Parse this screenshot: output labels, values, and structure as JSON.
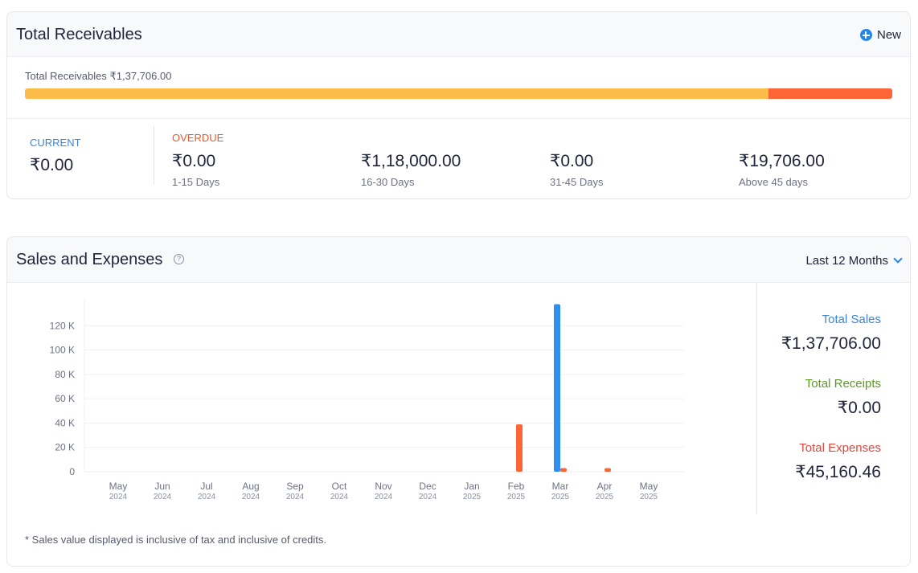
{
  "receivables": {
    "title": "Total Receivables",
    "new_label": "New",
    "total_text": "Total Receivables ₹1,37,706.00",
    "bar_split": {
      "current_fraction": 0.857,
      "overdue_fraction": 0.143
    },
    "colors": {
      "current": "#fcbc4a",
      "overdue": "#fc6535"
    },
    "current": {
      "label": "CURRENT",
      "value": "₹0.00"
    },
    "overdue_label": "OVERDUE",
    "buckets": [
      {
        "amount": "₹0.00",
        "range": "1-15 Days"
      },
      {
        "amount": "₹1,18,000.00",
        "range": "16-30 Days"
      },
      {
        "amount": "₹0.00",
        "range": "31-45 Days"
      },
      {
        "amount": "₹19,706.00",
        "range": "Above 45 days"
      }
    ]
  },
  "sales": {
    "title": "Sales and Expenses",
    "help_glyph": "?",
    "period_label": "Last 12 Months",
    "totals": [
      {
        "label": "Total Sales",
        "value": "₹1,37,706.00",
        "color": "#3e86d1"
      },
      {
        "label": "Total Receipts",
        "value": "₹0.00",
        "color": "#5c9a27"
      },
      {
        "label": "Total Expenses",
        "value": "₹45,160.46",
        "color": "#e0473f"
      }
    ],
    "footnote": "* Sales value displayed is inclusive of tax and inclusive of credits."
  },
  "chart_data": {
    "type": "bar",
    "categories": [
      "May",
      "Jun",
      "Jul",
      "Aug",
      "Sep",
      "Oct",
      "Nov",
      "Dec",
      "Jan",
      "Feb",
      "Mar",
      "Apr",
      "May"
    ],
    "category_years": [
      "2024",
      "2024",
      "2024",
      "2024",
      "2024",
      "2024",
      "2024",
      "2024",
      "2025",
      "2025",
      "2025",
      "2025",
      "2025"
    ],
    "series": [
      {
        "color": "#2f8ef2",
        "values": [
          0,
          0,
          0,
          0,
          0,
          0,
          0,
          0,
          0,
          0,
          137706,
          0,
          0
        ]
      },
      {
        "color": "#fc6535",
        "values": [
          0,
          0,
          0,
          0,
          0,
          0,
          0,
          0,
          0,
          39000,
          3000,
          3000,
          0
        ]
      }
    ],
    "yticks": [
      0,
      20000,
      40000,
      60000,
      80000,
      100000,
      120000
    ],
    "ytick_labels": [
      "0",
      "20 K",
      "40 K",
      "60 K",
      "80 K",
      "100 K",
      "120 K"
    ],
    "ylim": [
      0,
      140000
    ],
    "grid": true
  }
}
